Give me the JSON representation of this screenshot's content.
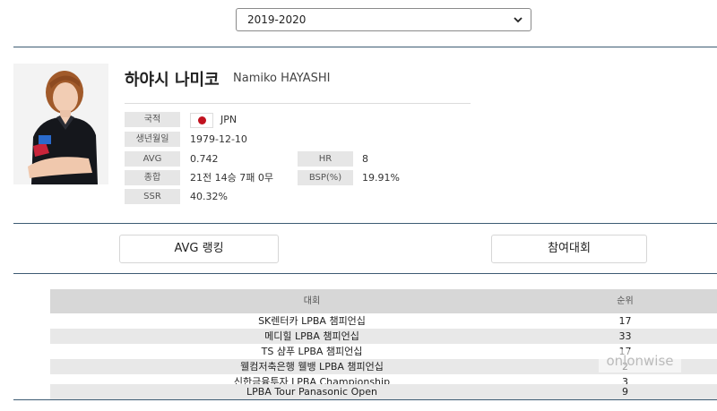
{
  "season_select": {
    "value": "2019-2020"
  },
  "player": {
    "name_ko": "하야시 나미코",
    "name_en": "Namiko HAYASHI",
    "fields": {
      "nationality_label": "국적",
      "nationality_value": "JPN",
      "birth_label": "생년월일",
      "birth_value": "1979-12-10",
      "avg_label": "AVG",
      "avg_value": "0.742",
      "hr_label": "HR",
      "hr_value": "8",
      "record_label": "종합",
      "record_value": "21전 14승 7패 0무",
      "bsp_label": "BSP(%)",
      "bsp_value": "19.91%",
      "ssr_label": "SSR",
      "ssr_value": "40.32%"
    },
    "flag_icon": "japan-flag-icon"
  },
  "buttons": {
    "avg_ranking": "AVG 랭킹",
    "tournaments": "참여대회"
  },
  "table": {
    "headers": [
      "대회",
      "순위"
    ],
    "rows": [
      {
        "tournament": "SK렌터카 LPBA 챔피언십",
        "rank": "17"
      },
      {
        "tournament": "메디힐 LPBA 챔피언십",
        "rank": "33"
      },
      {
        "tournament": "TS 샴푸 LPBA 챔피언십",
        "rank": "17"
      },
      {
        "tournament": "웰컴저축은행 웰뱅 LPBA 챔피언십",
        "rank": "2"
      },
      {
        "tournament": "신한금융투자 LPBA Championship",
        "rank": "3"
      },
      {
        "tournament": "LPBA Tour Panasonic Open",
        "rank": "9"
      }
    ]
  },
  "watermark": "onlonwise",
  "colors": {
    "divider": "#3d5b73",
    "flag_red": "#c1121f"
  }
}
